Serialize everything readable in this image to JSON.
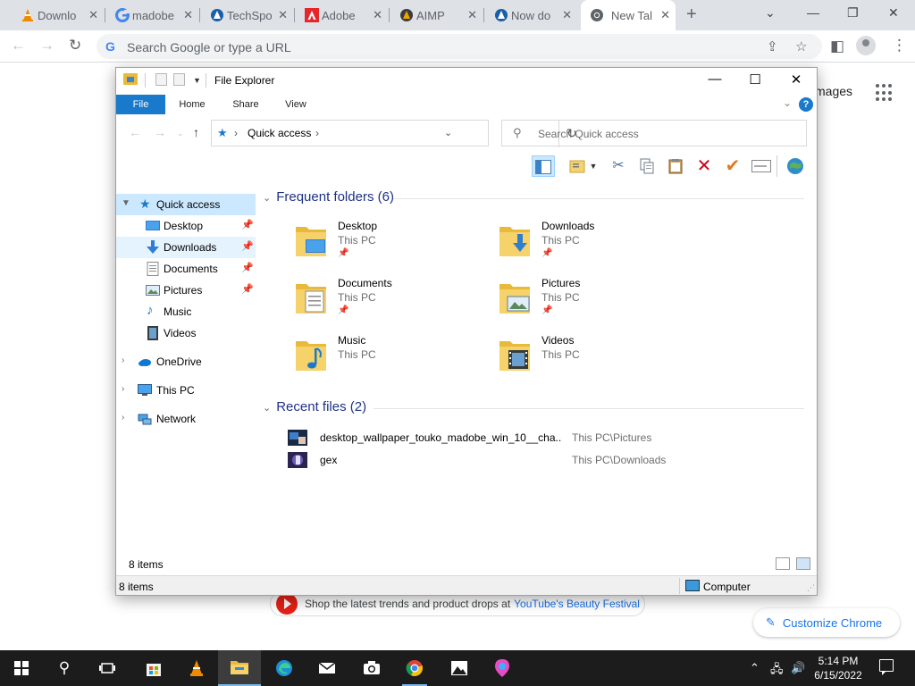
{
  "chrome": {
    "tabs": [
      {
        "label": "Downlo",
        "icon": "vlc-cone-icon"
      },
      {
        "label": "madobe",
        "icon": "google-g-icon"
      },
      {
        "label": "TechSpo",
        "icon": "techspot-icon"
      },
      {
        "label": "Adobe",
        "icon": "adobe-icon"
      },
      {
        "label": "AIMP",
        "icon": "aimp-icon"
      },
      {
        "label": "Now do",
        "icon": "techspot-icon"
      },
      {
        "label": "New Tal",
        "icon": "chrome-icon"
      }
    ],
    "omnibox_placeholder": "Search Google or type a URL",
    "ntp": {
      "images_label": "mages",
      "promo_text": "Shop the latest trends and product drops at",
      "promo_link": "YouTube's Beauty Festival",
      "customize_label": "Customize Chrome"
    }
  },
  "explorer": {
    "title": "File Explorer",
    "ribbon_tabs": [
      "File",
      "Home",
      "Share",
      "View"
    ],
    "address": "Quick access",
    "search_placeholder": "Search Quick access",
    "nav": {
      "quick_access": "Quick access",
      "pinned": [
        {
          "label": "Desktop",
          "pinned": true
        },
        {
          "label": "Downloads",
          "pinned": true
        },
        {
          "label": "Documents",
          "pinned": true
        },
        {
          "label": "Pictures",
          "pinned": true
        },
        {
          "label": "Music",
          "pinned": false
        },
        {
          "label": "Videos",
          "pinned": false
        }
      ],
      "onedrive": "OneDrive",
      "this_pc": "This PC",
      "network": "Network"
    },
    "frequent": {
      "header": "Frequent folders (6)",
      "folders": [
        {
          "name": "Desktop",
          "location": "This PC",
          "pinned": true
        },
        {
          "name": "Downloads",
          "location": "This PC",
          "pinned": true
        },
        {
          "name": "Documents",
          "location": "This PC",
          "pinned": true
        },
        {
          "name": "Pictures",
          "location": "This PC",
          "pinned": true
        },
        {
          "name": "Music",
          "location": "This PC",
          "pinned": false
        },
        {
          "name": "Videos",
          "location": "This PC",
          "pinned": false
        }
      ]
    },
    "recent": {
      "header": "Recent files (2)",
      "files": [
        {
          "name": "desktop_wallpaper_touko_madobe_win_10__cha...",
          "path": "This PC\\Pictures"
        },
        {
          "name": "gex",
          "path": "This PC\\Downloads"
        }
      ]
    },
    "status": {
      "items_top": "8 items",
      "items_bottom": "8 items",
      "computer": "Computer"
    }
  },
  "taskbar": {
    "time": "5:14 PM",
    "date": "6/15/2022"
  },
  "colors": {
    "accent": "#1979ca",
    "selected": "#cce8ff",
    "folder": "#e8b93a",
    "chrome_link": "#1a73e8"
  }
}
